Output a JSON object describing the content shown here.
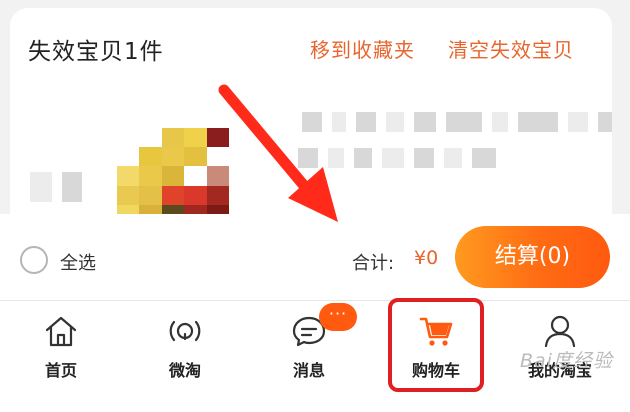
{
  "invalid_section": {
    "title": "失效宝贝1件",
    "move_to_favorites": "移到收藏夹",
    "clear_invalid": "清空失效宝贝"
  },
  "checkout_bar": {
    "select_all": "全选",
    "total_label": "合计:",
    "total_value": "¥0",
    "checkout_button": "结算(0)"
  },
  "tabbar": {
    "tabs": [
      {
        "label": "首页",
        "icon": "home-icon"
      },
      {
        "label": "微淘",
        "icon": "weitao-icon"
      },
      {
        "label": "消息",
        "icon": "message-icon",
        "badge": "···"
      },
      {
        "label": "购物车",
        "icon": "cart-icon",
        "highlighted": true
      },
      {
        "label": "我的淘宝",
        "icon": "person-icon"
      }
    ]
  },
  "watermark": "Bai度经验",
  "colors": {
    "accent": "#e8662d",
    "checkout_gradient_start": "#ff9a1f",
    "checkout_gradient_end": "#ff5a10",
    "highlight_box": "#e02020",
    "annotation_arrow": "#ff2a1a"
  }
}
